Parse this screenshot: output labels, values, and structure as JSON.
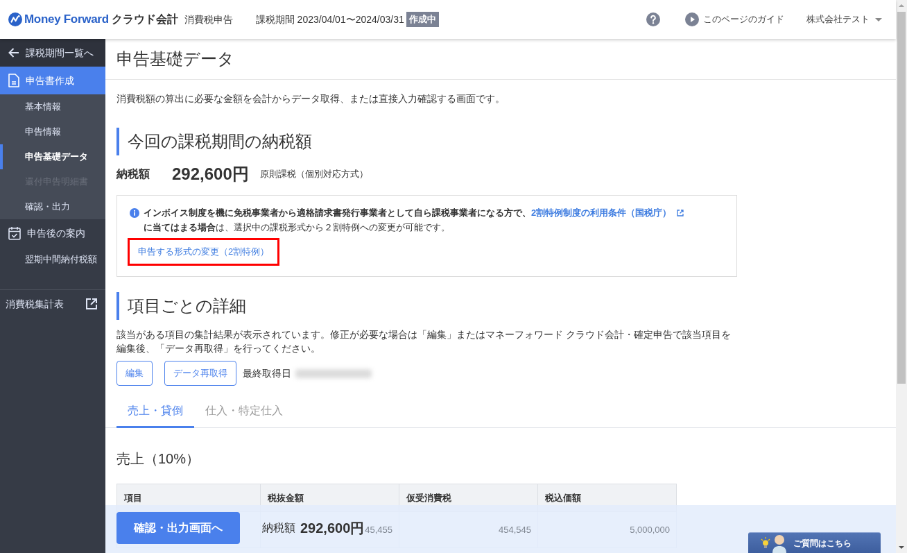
{
  "header": {
    "logo": {
      "brand": "Money Forward",
      "product": "クラウド会計"
    },
    "app_name": "消費税申告",
    "period": "課税期間 2023/04/01〜2024/03/31",
    "status_badge": "作成中",
    "guide_link": "このページのガイド",
    "company": "株式会社テスト"
  },
  "sidebar": {
    "back_link": "課税期間一覧へ",
    "groups": [
      {
        "kind": "document",
        "label": "申告書作成",
        "selected": true,
        "items": [
          {
            "label": "基本情報",
            "selected": false,
            "disabled": false
          },
          {
            "label": "申告情報",
            "selected": false,
            "disabled": false
          },
          {
            "label": "申告基礎データ",
            "selected": true,
            "disabled": false
          },
          {
            "label": "還付申告明細書",
            "selected": false,
            "disabled": true
          },
          {
            "label": "確認・出力",
            "selected": false,
            "disabled": false
          }
        ]
      },
      {
        "kind": "calendar",
        "label": "申告後の案内",
        "selected": false,
        "items": [
          {
            "label": "翌期中間納付税額",
            "selected": false,
            "disabled": false
          }
        ]
      }
    ],
    "external_link": "消費税集計表"
  },
  "page_title": "申告基礎データ",
  "intro": "消費税額の算出に必要な金額を会計からデータ取得、または直接入力確認する画面です。",
  "tax_section": {
    "heading": "今回の課税期間の納税額",
    "amount_label": "納税額",
    "amount": "292,600円",
    "method": "原則課税（個別対応方式）",
    "notice": {
      "lead": "インボイス制度を機に免税事業者から適格請求書発行事業者として自ら課税事業者になる方で、",
      "link": "2割特例制度の利用条件（国税庁）",
      "tail": "**に当てはまる場合**は、選択中の課税形式から２割特例への変更が可能です。"
    },
    "change_link": {
      "label": "申告する形式の変更（2割特例）",
      "highlighted": true
    }
  },
  "detail_section": {
    "heading": "項目ごとの詳細",
    "description": "該当がある項目の集計結果が表示されています。修正が必要な場合は「編集」またはマネーフォワード クラウド会計・確定申告で該当項目を編集後、「データ再取得」を行ってください。",
    "buttons": [
      "編集",
      "データ再取得"
    ],
    "last_fetched_label": "最終取得日",
    "tabs": [
      {
        "label": "売上・貸倒",
        "selected": true
      },
      {
        "label": "仕入・特定仕入",
        "selected": false
      }
    ],
    "subheading": "売上（10%）",
    "table": {
      "columns": [
        "項目",
        "税抜金額",
        "仮受消費税",
        "税込価額"
      ],
      "rows": [
        {
          "cells": [
            null,
            "45,455",
            "454,545",
            "5,000,000"
          ]
        }
      ]
    }
  },
  "footer_bar": {
    "button": "確認・出力画面へ",
    "amount_label": "納税額",
    "amount": "292,600円"
  },
  "help_button": "ご質問はこちら"
}
